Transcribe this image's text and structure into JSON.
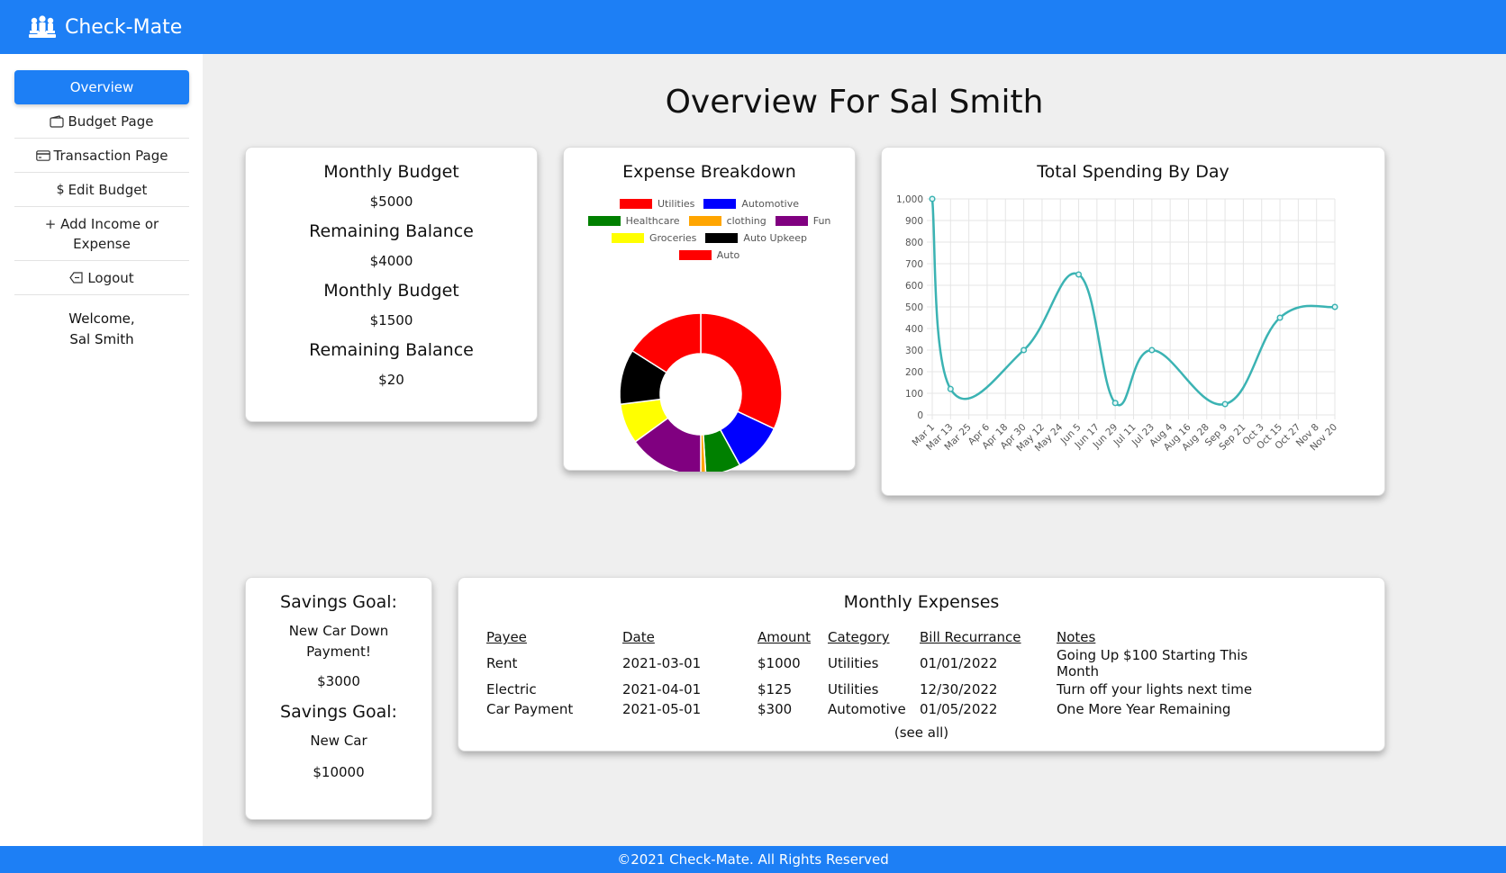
{
  "app": {
    "name": "Check-Mate"
  },
  "sidebar": {
    "items": [
      {
        "label": "Overview",
        "icon": "none"
      },
      {
        "label": "Budget Page",
        "icon": "wallet-icon"
      },
      {
        "label": "Transaction Page",
        "icon": "credit-card-icon"
      },
      {
        "label": "Edit Budget",
        "icon": "dollar-icon"
      },
      {
        "label": "Add Income or Expense",
        "icon": "plus-icon"
      },
      {
        "label": "Logout",
        "icon": "logout-icon"
      }
    ],
    "welcome_line1": "Welcome,",
    "welcome_line2": "Sal Smith"
  },
  "page": {
    "title": "Overview For Sal Smith"
  },
  "budget": [
    {
      "heading": "Monthly Budget",
      "value": "$5000"
    },
    {
      "heading": "Remaining Balance",
      "value": "$4000"
    },
    {
      "heading": "Monthly Budget",
      "value": "$1500"
    },
    {
      "heading": "Remaining Balance",
      "value": "$20"
    }
  ],
  "expense_breakdown": {
    "title": "Expense Breakdown"
  },
  "spending": {
    "title": "Total Spending By Day"
  },
  "savings": [
    {
      "heading": "Savings Goal:",
      "name_line1": "New Car Down",
      "name_line2": "Payment!",
      "amount": "$3000"
    },
    {
      "heading": "Savings Goal:",
      "name_line1": "New Car",
      "name_line2": "",
      "amount": "$10000"
    }
  ],
  "monthly_expenses": {
    "title": "Monthly Expenses",
    "headers": [
      "Payee",
      "Date",
      "Amount",
      "Category",
      "Bill Recurrance",
      "Notes"
    ],
    "rows": [
      [
        "Rent",
        "2021-03-01",
        "$1000",
        "Utilities",
        "01/01/2022",
        "Going Up $100 Starting This Month"
      ],
      [
        "Electric",
        "2021-04-01",
        "$125",
        "Utilities",
        "12/30/2022",
        "Turn off your lights next time"
      ],
      [
        "Car Payment",
        "2021-05-01",
        "$300",
        "Automotive",
        "01/05/2022",
        "One More Year Remaining"
      ]
    ],
    "see_all": "(see all)"
  },
  "footer": {
    "text": "©2021 Check-Mate. All Rights Reserved"
  },
  "colors": {
    "accent": "#1d7ff5",
    "line": "#3bb3b3"
  },
  "chart_data": [
    {
      "type": "pie",
      "title": "Expense Breakdown",
      "legend_position": "top",
      "categories": [
        "Utilities",
        "Automotive",
        "Healthcare",
        "clothing",
        "Fun",
        "Groceries",
        "Auto Upkeep",
        "Auto"
      ],
      "colors": [
        "#ff0000",
        "#0000ff",
        "#008000",
        "#ffa500",
        "#800080",
        "#ffff00",
        "#000000",
        "#ff0000"
      ],
      "values": [
        32,
        10,
        7,
        1,
        15,
        8,
        11,
        16
      ]
    },
    {
      "type": "line",
      "title": "Total Spending By Day",
      "x": [
        "Mar 1",
        "Mar 13",
        "Mar 25",
        "Apr 6",
        "Apr 18",
        "Apr 30",
        "May 12",
        "May 24",
        "Jun 5",
        "Jun 17",
        "Jun 29",
        "Jul 11",
        "Jul 23",
        "Aug 4",
        "Aug 16",
        "Aug 28",
        "Sep 9",
        "Sep 21",
        "Oct 3",
        "Oct 15",
        "Oct 27",
        "Nov 8",
        "Nov 20"
      ],
      "points": [
        {
          "x": "Mar 1",
          "y": 1000
        },
        {
          "x": "Mar 13",
          "y": 120
        },
        {
          "x": "Apr 30",
          "y": 300
        },
        {
          "x": "Jun 5",
          "y": 650
        },
        {
          "x": "Jun 29",
          "y": 55
        },
        {
          "x": "Jul 23",
          "y": 300
        },
        {
          "x": "Sep 9",
          "y": 50
        },
        {
          "x": "Oct 15",
          "y": 450
        },
        {
          "x": "Nov 20",
          "y": 500
        }
      ],
      "ylim": [
        0,
        1000
      ],
      "yticks": [
        "0",
        "100",
        "200",
        "300",
        "400",
        "500",
        "600",
        "700",
        "800",
        "900",
        "1,000"
      ],
      "grid": true
    }
  ]
}
